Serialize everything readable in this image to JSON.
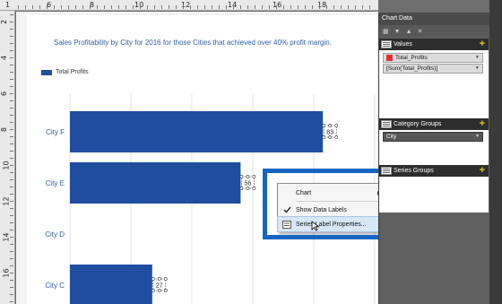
{
  "ruler": {
    "top_numbers": [
      "1",
      "6",
      "8",
      "10",
      "12",
      "14",
      "16",
      "18"
    ],
    "left_numbers": [
      "2",
      "4",
      "6",
      "8",
      "10",
      "12",
      "14",
      "16"
    ]
  },
  "chart": {
    "title": "Sales Profitability by City for 2016 for those Cities that achieved over 40% profit margin.",
    "legend_label": "Total Profits"
  },
  "chart_data": {
    "type": "bar",
    "orientation": "horizontal",
    "title": "Sales Profitability by City for 2016 for those Cities that achieved over 40% profit margin.",
    "categories": [
      "City F",
      "City E",
      "City D",
      "City C"
    ],
    "series": [
      {
        "name": "Total Profits",
        "values": [
          83,
          56,
          0,
          27
        ]
      }
    ],
    "data_labels": [
      "83",
      "56",
      "",
      "27"
    ],
    "xlim": [
      0,
      100
    ],
    "grid": true,
    "legend": "top-left"
  },
  "context_menu": {
    "items": [
      {
        "label": "Chart",
        "has_submenu": true
      },
      {
        "label": "Show Data Labels",
        "checked": true
      },
      {
        "label": "Series Label Properties..."
      }
    ]
  },
  "chart_data_panel": {
    "title": "Chart Data",
    "values_header": "Values",
    "values_field": "Total_Profits",
    "values_expression": "[Sum(Total_Profits)]",
    "category_header": "Category Groups",
    "category_field": "City",
    "series_header": "Series Groups"
  },
  "colors": {
    "bar": "#1f4ea0",
    "title": "#2e5ea6",
    "highlight": "#1565c0"
  }
}
